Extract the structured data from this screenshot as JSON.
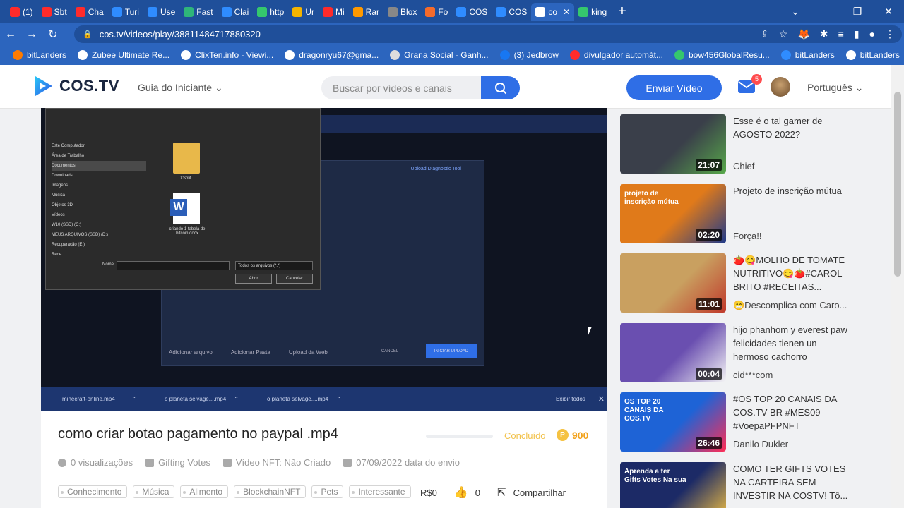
{
  "browser": {
    "tabs": [
      {
        "label": "(1)",
        "color": "#ff2b2b"
      },
      {
        "label": "Sbt",
        "color": "#ff2b2b"
      },
      {
        "label": "Cha",
        "color": "#ff2b2b"
      },
      {
        "label": "Turi",
        "color": "#2f8cff"
      },
      {
        "label": "Use",
        "color": "#2f8cff"
      },
      {
        "label": "Fast",
        "color": "#2fb67a"
      },
      {
        "label": "Clai",
        "color": "#2f8cff"
      },
      {
        "label": "http",
        "color": "#35c76d"
      },
      {
        "label": "Ur",
        "color": "#f5b400"
      },
      {
        "label": "Mi",
        "color": "#ff2b2b"
      },
      {
        "label": "Rar",
        "color": "#ff9900"
      },
      {
        "label": "Blox",
        "color": "#888888"
      },
      {
        "label": "Fo",
        "color": "#f56b2b"
      },
      {
        "label": "COS",
        "color": "#2f8cff"
      },
      {
        "label": "COS",
        "color": "#2f8cff"
      },
      {
        "label": "co",
        "color": "#ffffff",
        "active": true
      },
      {
        "label": "king",
        "color": "#35c76d"
      }
    ],
    "url": "cos.tv/videos/play/38811484717880320",
    "bookmarks": [
      {
        "label": "bitLanders",
        "color": "#ff7b00"
      },
      {
        "label": "Zubee Ultimate Re...",
        "color": "#ffffff"
      },
      {
        "label": "ClixTen.info - Viewi...",
        "color": "#ffffff"
      },
      {
        "label": "dragonryu67@gma...",
        "color": "#ffffff"
      },
      {
        "label": "Grana Social - Ganh...",
        "color": "#dddddd"
      },
      {
        "label": "(3) Jedbrow",
        "color": "#1877f2"
      },
      {
        "label": "divulgador automát...",
        "color": "#ff2b2b"
      },
      {
        "label": "bow456GlobalResu...",
        "color": "#35c76d"
      },
      {
        "label": "bitLanders",
        "color": "#2f8cff"
      },
      {
        "label": "bitLanders",
        "color": "#ffffff"
      }
    ]
  },
  "header": {
    "logo": "COS.TV",
    "guide": "Guia do Iniciante",
    "search_placeholder": "Buscar por vídeos e canais",
    "upload_button": "Enviar Vídeo",
    "mail_badge": "5",
    "language": "Português"
  },
  "video": {
    "dialog": {
      "sidebar": [
        "Este Computador",
        "Área de Trabalho",
        "Documentos",
        "Downloads",
        "Imagens",
        "Música",
        "Objetos 3D",
        "Vídeos",
        "W10 (SSD) (C:)",
        "MEUS ARQUIVOS (SSD) (D:)",
        "Recuperação (E:)",
        "Rede"
      ],
      "name_label": "Nome",
      "type_value": "Todos os arquivos (*.*)",
      "open": "Abrir",
      "cancel": "Cancelar",
      "folder_label": "XSplit",
      "doc_label": "criando 1 tabela de bitcoin.docx"
    },
    "upload": {
      "title": "Upload Diagnostic Tool",
      "add_file": "Adicionar arquivo",
      "add_folder": "Adicionar Pasta",
      "web": "Upload da Web",
      "cancel": "CANCEL",
      "start": "INICIAR UPLOAD"
    },
    "downloads": [
      "minecraft-online.mp4",
      "o planeta selvage....mp4",
      "o planeta selvage....mp4"
    ],
    "show_all": "Exibir todos"
  },
  "info": {
    "title": "como criar botao pagamento no paypal .mp4",
    "progress": 0,
    "status": "Concluído",
    "coins": "900",
    "views": "0 visualizações",
    "gifting": "Gifting Votes",
    "nft": "Vídeo NFT: Não Criado",
    "date": "07/09/2022 data do envio",
    "tags": [
      "Conhecimento",
      "Música",
      "Alimento",
      "BlockchainNFT",
      "Pets",
      "Interessante"
    ],
    "price": "R$0",
    "likes": "0",
    "share": "Compartilhar"
  },
  "sidebar": [
    {
      "title": "Esse é o tal gamer de AGOSTO 2022?",
      "channel": "Chief",
      "duration": "21:07",
      "bg": "#3a3f4a",
      "accent": "#57a84a"
    },
    {
      "title": "Projeto de inscrição mútua",
      "channel": "Força!!",
      "duration": "02:20",
      "bg": "#e07a1a",
      "accent": "#1f3a8a",
      "overlay": "projeto de inscrição mútua"
    },
    {
      "title": "🍅😋MOLHO DE TOMATE NUTRITIVO😋🍅#CAROL BRITO #RECEITAS...",
      "channel": "😁Descomplica com Caro...",
      "duration": "11:01",
      "bg": "#c9a060",
      "accent": "#c0392b"
    },
    {
      "title": "hijo phanhom y everest paw felicidades tienen un hermoso cachorro",
      "channel": "cid***com",
      "duration": "00:04",
      "bg": "#6a4fb0",
      "accent": "#f5f5f5"
    },
    {
      "title": "#OS TOP 20 CANAIS DA COS.TV BR #MES09 #VoepaPFPNFT",
      "channel": "Danilo Dukler",
      "duration": "26:46",
      "bg": "#1e63d6",
      "accent": "#ff2d55",
      "overlay": "OS TOP 20 CANAIS DA COS.TV"
    },
    {
      "title": "COMO TER GIFTS VOTES NA CARTEIRA SEM INVESTIR NA COSTV! Tô...",
      "channel": "",
      "duration": "",
      "bg": "#1c2a66",
      "accent": "#f5c242",
      "overlay": "Aprenda a ter Gifts Votes Na sua"
    }
  ]
}
